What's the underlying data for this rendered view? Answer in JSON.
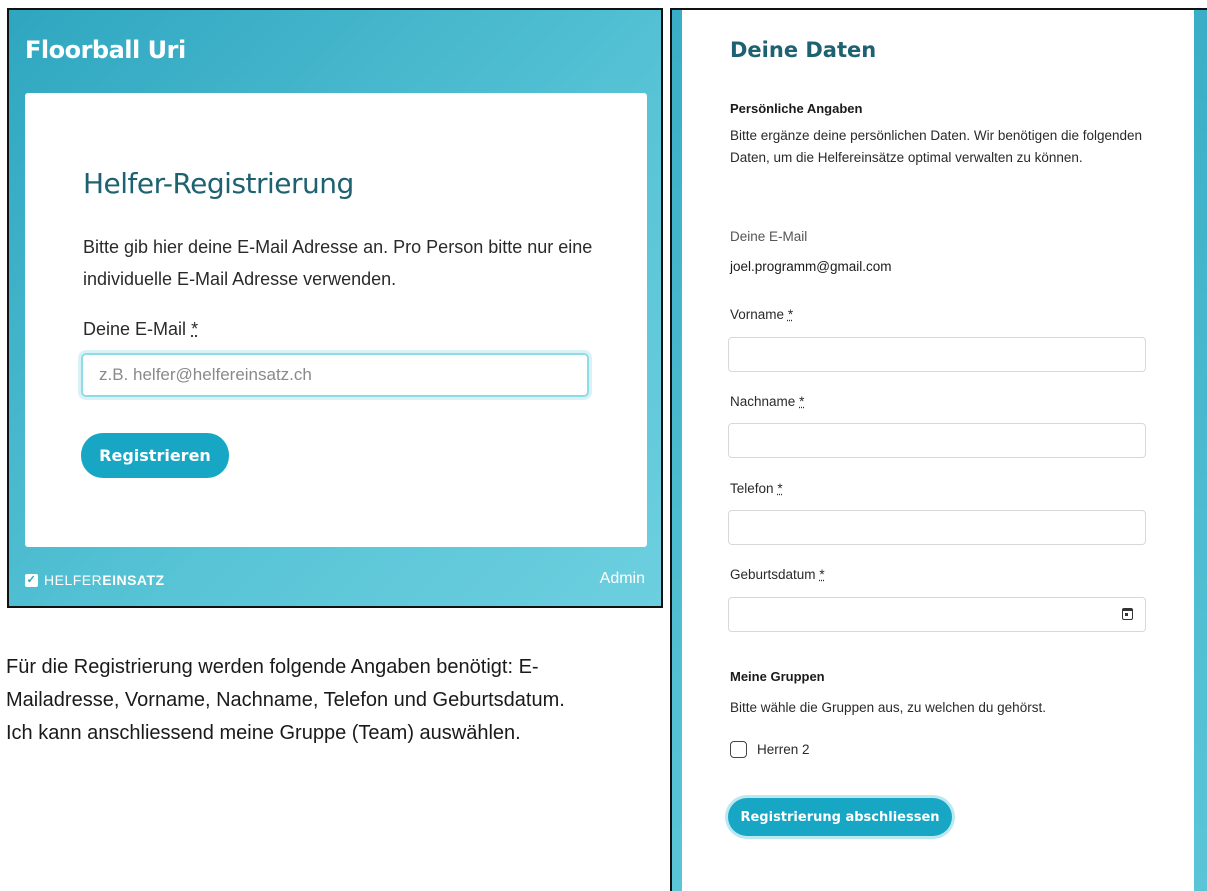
{
  "login": {
    "brand": "Floorball Uri",
    "title": "Helfer-Registrierung",
    "intro": "Bitte gib hier deine E-Mail Adresse an. Pro Person bitte nur eine individuelle E-Mail Adresse verwenden.",
    "email_label": "Deine E-Mail",
    "required_mark": "*",
    "email_placeholder": "z.B. helfer@helfereinsatz.ch",
    "register_button": "Registrieren",
    "footer_logo_light": "HELFER",
    "footer_logo_heavy": "EINSATZ",
    "admin_link": "Admin"
  },
  "caption": "Für die Registrierung werden folgende Angaben benötigt: E-Mailadresse, Vorname, Nachname, Telefon und Geburtsdatum. Ich kann anschliessend meine Gruppe (Team) auswählen.",
  "form": {
    "title": "Deine Daten",
    "personal": {
      "title": "Persönliche Angaben",
      "desc": "Bitte ergänze deine persönlichen Daten. Wir benötigen die folgenden Daten, um die Helfereinsätze optimal verwalten zu können."
    },
    "email_label": "Deine E-Mail",
    "email_value": "joel.programm@gmail.com",
    "required_mark": "*",
    "firstname_label": "Vorname",
    "lastname_label": "Nachname",
    "phone_label": "Telefon",
    "birthdate_label": "Geburtsdatum",
    "groups": {
      "title": "Meine Gruppen",
      "desc": "Bitte wähle die Gruppen aus, zu welchen du gehörst.",
      "items": [
        {
          "label": "Herren 2",
          "checked": false
        }
      ]
    },
    "submit_button": "Registrierung abschliessen"
  },
  "icons": {
    "logo": "check-square-icon",
    "date_picker": "calendar-icon",
    "checkbox": "checkbox-icon"
  },
  "colors": {
    "accent": "#17a7c5",
    "heading": "#1e6272",
    "brand_background": "#3fb3c9"
  }
}
